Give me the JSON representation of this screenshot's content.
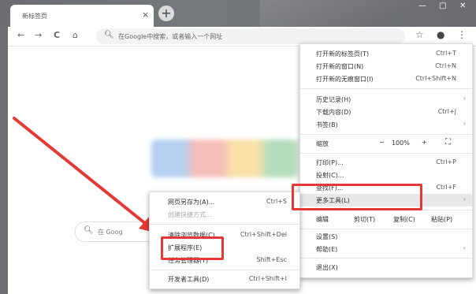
{
  "window": {
    "tab_title": "新标签页",
    "tab_close": "×",
    "new_tab": "+",
    "controls": {
      "minimize": "—",
      "maximize": "□",
      "close": "✕"
    }
  },
  "toolbar": {
    "back": "←",
    "forward": "→",
    "reload": "C",
    "home": "⌂",
    "omnibox_placeholder": "在Google中搜索，或者输入一个网址",
    "bookmark": "☆",
    "profile": "●",
    "menu": "⋮"
  },
  "page": {
    "search_placeholder": "在 Goog"
  },
  "menu": {
    "new_tab": {
      "label": "打开新的标签页(T)",
      "shortcut": "Ctrl+T"
    },
    "new_window": {
      "label": "打开新的窗口(N)",
      "shortcut": "Ctrl+N"
    },
    "incognito": {
      "label": "打开新的无痕窗口(I)",
      "shortcut": "Ctrl+Shift+N"
    },
    "history": {
      "label": "历史记录(H)"
    },
    "downloads": {
      "label": "下载内容(D)",
      "shortcut": "Ctrl+J"
    },
    "bookmarks": {
      "label": "书签(B)"
    },
    "zoom": {
      "label": "缩放",
      "minus": "−",
      "value": "100%",
      "plus": "+",
      "fullscreen": "⛶"
    },
    "print": {
      "label": "打印(P)...",
      "shortcut": "Ctrl+P"
    },
    "cast": {
      "label": "投射(C)..."
    },
    "find": {
      "label": "查找(F)...",
      "shortcut": "Ctrl+F"
    },
    "more_tools": {
      "label": "更多工具(L)"
    },
    "edit": {
      "label": "编辑",
      "cut": "剪切(T)",
      "copy": "复制(C)",
      "paste": "粘贴(P)"
    },
    "settings": {
      "label": "设置(S)"
    },
    "help": {
      "label": "帮助(E)"
    },
    "exit": {
      "label": "退出(X)"
    }
  },
  "submenu": {
    "save_page": {
      "label": "网页另存为(A)...",
      "shortcut": "Ctrl+S"
    },
    "create_shortcut": {
      "label": "创建快捷方式..."
    },
    "clear_data": {
      "label": "清除浏览数据(C)...",
      "shortcut": "Ctrl+Shift+Del"
    },
    "extensions": {
      "label": "扩展程序(E)"
    },
    "task_manager": {
      "label": "任务管理器(T)",
      "shortcut": "Shift+Esc"
    },
    "dev_tools": {
      "label": "开发者工具(D)",
      "shortcut": "Ctrl+Shift+I"
    }
  },
  "colors": {
    "highlight": "#e53935",
    "arrow": "#e53935"
  }
}
